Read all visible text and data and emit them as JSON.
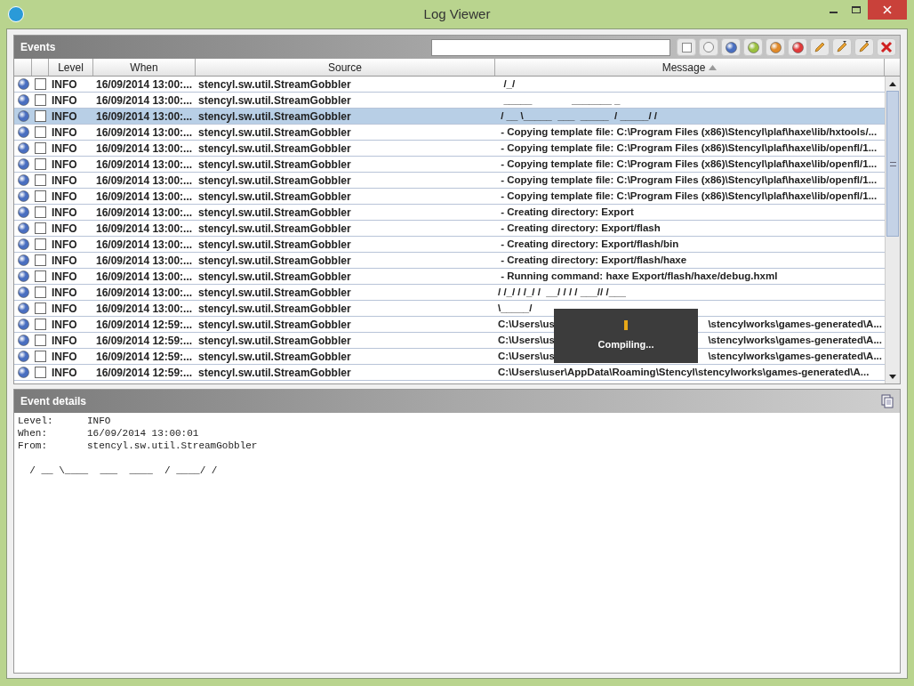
{
  "window": {
    "title": "Log Viewer"
  },
  "events": {
    "title": "Events",
    "columns": [
      {
        "label": "Level",
        "sorted": false
      },
      {
        "label": "When",
        "sorted": false
      },
      {
        "label": "Source",
        "sorted": false
      },
      {
        "label": "Message",
        "sorted": true
      }
    ],
    "rows": [
      {
        "level": "INFO",
        "when": "16/09/2014 13:00:...",
        "source": "stencyl.sw.util.StreamGobbler",
        "message": "  /_/",
        "checked": false,
        "selected": false
      },
      {
        "level": "INFO",
        "when": "16/09/2014 13:00:...",
        "source": "stencyl.sw.util.StreamGobbler",
        "message": "  _____              _______ _",
        "checked": false,
        "selected": false
      },
      {
        "level": "INFO",
        "when": "16/09/2014 13:00:...",
        "source": "stencyl.sw.util.StreamGobbler",
        "message": " / __ \\_____  ___  _____  / _____/ /",
        "checked": false,
        "selected": true
      },
      {
        "level": "INFO",
        "when": "16/09/2014 13:00:...",
        "source": "stencyl.sw.util.StreamGobbler",
        "message": " - Copying template file: C:\\Program Files (x86)\\Stencyl\\plaf\\haxe\\lib/hxtools/...",
        "checked": false,
        "selected": false
      },
      {
        "level": "INFO",
        "when": "16/09/2014 13:00:...",
        "source": "stencyl.sw.util.StreamGobbler",
        "message": " - Copying template file: C:\\Program Files (x86)\\Stencyl\\plaf\\haxe\\lib/openfl/1...",
        "checked": false,
        "selected": false
      },
      {
        "level": "INFO",
        "when": "16/09/2014 13:00:...",
        "source": "stencyl.sw.util.StreamGobbler",
        "message": " - Copying template file: C:\\Program Files (x86)\\Stencyl\\plaf\\haxe\\lib/openfl/1...",
        "checked": false,
        "selected": false
      },
      {
        "level": "INFO",
        "when": "16/09/2014 13:00:...",
        "source": "stencyl.sw.util.StreamGobbler",
        "message": " - Copying template file: C:\\Program Files (x86)\\Stencyl\\plaf\\haxe\\lib/openfl/1...",
        "checked": false,
        "selected": false
      },
      {
        "level": "INFO",
        "when": "16/09/2014 13:00:...",
        "source": "stencyl.sw.util.StreamGobbler",
        "message": " - Copying template file: C:\\Program Files (x86)\\Stencyl\\plaf\\haxe\\lib/openfl/1...",
        "checked": false,
        "selected": false
      },
      {
        "level": "INFO",
        "when": "16/09/2014 13:00:...",
        "source": "stencyl.sw.util.StreamGobbler",
        "message": " - Creating directory: Export",
        "checked": false,
        "selected": false
      },
      {
        "level": "INFO",
        "when": "16/09/2014 13:00:...",
        "source": "stencyl.sw.util.StreamGobbler",
        "message": " - Creating directory: Export/flash",
        "checked": false,
        "selected": false
      },
      {
        "level": "INFO",
        "when": "16/09/2014 13:00:...",
        "source": "stencyl.sw.util.StreamGobbler",
        "message": " - Creating directory: Export/flash/bin",
        "checked": false,
        "selected": false
      },
      {
        "level": "INFO",
        "when": "16/09/2014 13:00:...",
        "source": "stencyl.sw.util.StreamGobbler",
        "message": " - Creating directory: Export/flash/haxe",
        "checked": false,
        "selected": false
      },
      {
        "level": "INFO",
        "when": "16/09/2014 13:00:...",
        "source": "stencyl.sw.util.StreamGobbler",
        "message": " - Running command: haxe Export/flash/haxe/debug.hxml",
        "checked": false,
        "selected": false
      },
      {
        "level": "INFO",
        "when": "16/09/2014 13:00:...",
        "source": "stencyl.sw.util.StreamGobbler",
        "message": "/ /_/ / /_/ /  __/ / / / ___// /___",
        "checked": false,
        "selected": false
      },
      {
        "level": "INFO",
        "when": "16/09/2014 13:00:...",
        "source": "stencyl.sw.util.StreamGobbler",
        "message": "\\_____/",
        "checked": false,
        "selected": false
      },
      {
        "level": "INFO",
        "when": "16/09/2014 12:59:...",
        "source": "stencyl.sw.util.StreamGobbler",
        "message": "C:\\Users\\us",
        "message_tail": "\\stencylworks\\games-generated\\A...",
        "checked": false,
        "selected": false
      },
      {
        "level": "INFO",
        "when": "16/09/2014 12:59:...",
        "source": "stencyl.sw.util.StreamGobbler",
        "message": "C:\\Users\\us",
        "message_tail": "\\stencylworks\\games-generated\\A...",
        "checked": false,
        "selected": false
      },
      {
        "level": "INFO",
        "when": "16/09/2014 12:59:...",
        "source": "stencyl.sw.util.StreamGobbler",
        "message": "C:\\Users\\us",
        "message_tail": "\\stencylworks\\games-generated\\A...",
        "checked": false,
        "selected": false
      },
      {
        "level": "INFO",
        "when": "16/09/2014 12:59:...",
        "source": "stencyl.sw.util.StreamGobbler",
        "message": "C:\\Users\\user\\AppData\\Roaming\\Stencyl\\stencylworks\\games-generated\\A...",
        "checked": false,
        "selected": false
      }
    ]
  },
  "overlay": {
    "text": "Compiling..."
  },
  "details": {
    "title": "Event details",
    "fields": [
      {
        "label": "Level:",
        "value": "INFO"
      },
      {
        "label": "When:",
        "value": "16/09/2014 13:00:01"
      },
      {
        "label": "From:",
        "value": "stencyl.sw.util.StreamGobbler"
      }
    ],
    "body": "  / __ \\____  ___  ____  / ____/ /"
  }
}
